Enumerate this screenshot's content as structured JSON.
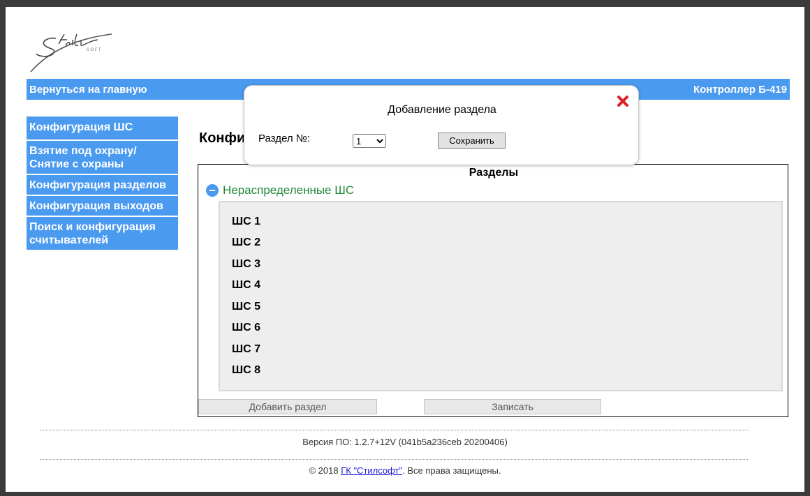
{
  "header": {
    "home_link": "Вернуться на главную",
    "controller_title": "Контроллер Б-419"
  },
  "sidebar": {
    "items": [
      {
        "label": "Конфигурация ШС"
      },
      {
        "label": "Взятие под охрану/ Снятие с охраны"
      },
      {
        "label": "Конфигурация разделов"
      },
      {
        "label": "Конфигурация выходов"
      },
      {
        "label": "Поиск и конфигурация считывателей"
      }
    ]
  },
  "main": {
    "page_title_visible": "Конфи",
    "panel_title": "Разделы",
    "group_label": "Нераспределенные ШС",
    "loops": [
      "ШС 1",
      "ШС 2",
      "ШС 3",
      "ШС 4",
      "ШС 5",
      "ШС 6",
      "ШС 7",
      "ШС 8"
    ],
    "add_section_button": "Добавить раздел",
    "write_button": "Записать"
  },
  "dialog": {
    "title": "Добавление раздела",
    "section_label": "Раздел №:",
    "section_value": "1",
    "save_button": "Сохранить"
  },
  "footer": {
    "version": "Версия ПО: 1.2.7+12V (041b5a236ceb 20200406)",
    "copyright_prefix": "© 2018 ",
    "company_link": "ГК \"Стилсофт\"",
    "copyright_suffix": ". Все права защищены."
  },
  "colors": {
    "accent": "#4a9af0",
    "group_text": "#22883a",
    "close_icon": "#e02020",
    "link": "#1a1ad6"
  }
}
